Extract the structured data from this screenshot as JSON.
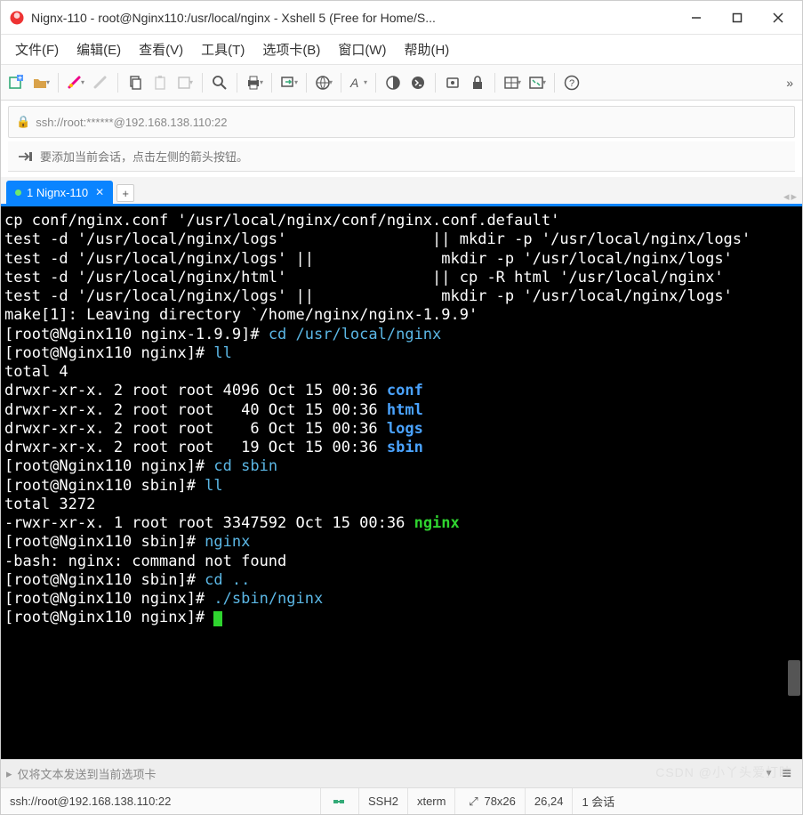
{
  "window": {
    "title": "Nignx-110 - root@Nginx110:/usr/local/nginx - Xshell 5 (Free for Home/S..."
  },
  "menu": {
    "file": "文件(F)",
    "edit": "编辑(E)",
    "view": "查看(V)",
    "tools": "工具(T)",
    "tabs": "选项卡(B)",
    "window": "窗口(W)",
    "help": "帮助(H)"
  },
  "address": {
    "url": "ssh://root:******@192.168.138.110:22"
  },
  "hint": {
    "text": "要添加当前会话，点击左侧的箭头按钮。"
  },
  "tab": {
    "index": "1",
    "name": "Nignx-110"
  },
  "inputbar": {
    "text": "仅将文本发送到当前选项卡"
  },
  "status": {
    "ssh": "ssh://root@192.168.138.110:22",
    "proto": "SSH2",
    "term": "xterm",
    "size": "78x26",
    "cursor": "26,24",
    "sessions": "1 会话"
  },
  "watermark": "CSDN @小丫头爱打盹",
  "term": {
    "l1": "cp conf/nginx.conf '/usr/local/nginx/conf/nginx.conf.default'",
    "l2": "test -d '/usr/local/nginx/logs'                || mkdir -p '/usr/local/nginx/logs'",
    "l3": "test -d '/usr/local/nginx/logs' ||              mkdir -p '/usr/local/nginx/logs'",
    "l4": "test -d '/usr/local/nginx/html'                || cp -R html '/usr/local/nginx'",
    "l5": "test -d '/usr/local/nginx/logs' ||              mkdir -p '/usr/local/nginx/logs'",
    "l6": "make[1]: Leaving directory `/home/nginx/nginx-1.9.9'",
    "p1": "[root@Nginx110 nginx-1.9.9]# ",
    "c1": "cd /usr/local/nginx",
    "p2": "[root@Nginx110 nginx]# ",
    "c2": "ll",
    "l7": "total 4",
    "d1a": "drwxr-xr-x. 2 root root 4096 Oct 15 00:36 ",
    "d1b": "conf",
    "d2a": "drwxr-xr-x. 2 root root   40 Oct 15 00:36 ",
    "d2b": "html",
    "d3a": "drwxr-xr-x. 2 root root    6 Oct 15 00:36 ",
    "d3b": "logs",
    "d4a": "drwxr-xr-x. 2 root root   19 Oct 15 00:36 ",
    "d4b": "sbin",
    "p3": "[root@Nginx110 nginx]# ",
    "c3": "cd sbin",
    "p4": "[root@Nginx110 sbin]# ",
    "c4": "ll",
    "l8": "total 3272",
    "f1a": "-rwxr-xr-x. 1 root root 3347592 Oct 15 00:36 ",
    "f1b": "nginx",
    "p5": "[root@Nginx110 sbin]# ",
    "c5": "nginx",
    "l9": "-bash: nginx: command not found",
    "p6": "[root@Nginx110 sbin]# ",
    "c6": "cd ..",
    "p7": "[root@Nginx110 nginx]# ",
    "c7": "./sbin/nginx",
    "p8": "[root@Nginx110 nginx]# "
  }
}
